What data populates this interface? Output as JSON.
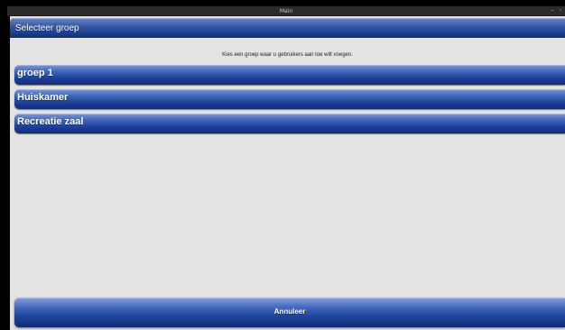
{
  "window": {
    "title": "Main",
    "controls": {
      "minimize": "–",
      "maximize": "▫"
    }
  },
  "header": {
    "title": "Selecteer groep"
  },
  "instruction": "Kies een groep waar u gebruikers aan toe wilt voegen.",
  "groups": [
    {
      "label": "groep 1"
    },
    {
      "label": "Huiskamer"
    },
    {
      "label": "Recreatie zaal"
    }
  ],
  "footer": {
    "cancel_label": "Annuleer"
  },
  "colors": {
    "accent": "#1d3f8e",
    "background": "#e3e3e3",
    "titlebar": "#2b2b2b"
  }
}
